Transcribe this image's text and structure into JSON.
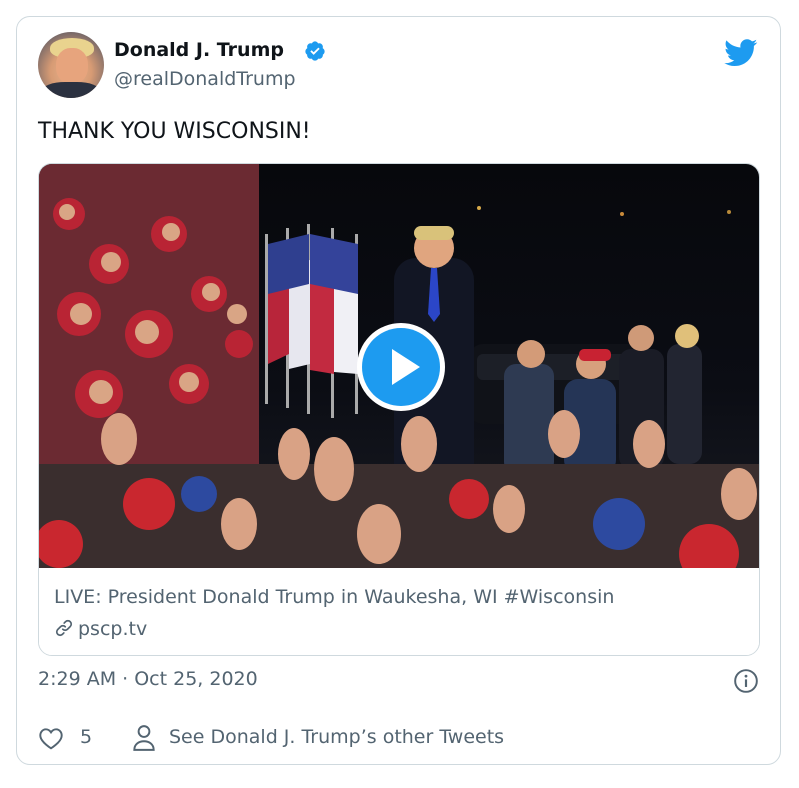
{
  "tweet": {
    "author_name": "Donald J. Trump",
    "author_handle": "@realDonaldTrump",
    "verified": true,
    "text": "THANK YOU WISCONSIN!",
    "timestamp": "2:29 AM · Oct 25, 2020"
  },
  "media": {
    "title": "LIVE: President Donald Trump in Waukesha, WI #Wisconsin",
    "link": "pscp.tv",
    "play_icon": "play-icon"
  },
  "actions": {
    "like_count": "5",
    "other_tweets_label": "See Donald J. Trump’s other Tweets"
  },
  "icons": {
    "brand": "twitter-bird-icon",
    "verified": "verified-badge-icon",
    "info": "info-icon",
    "like": "heart-icon",
    "profile": "person-icon",
    "link": "link-icon"
  },
  "colors": {
    "accent": "#1d9bf0",
    "text": "#0f1419",
    "secondary": "#536471",
    "border": "#cfd9de"
  }
}
